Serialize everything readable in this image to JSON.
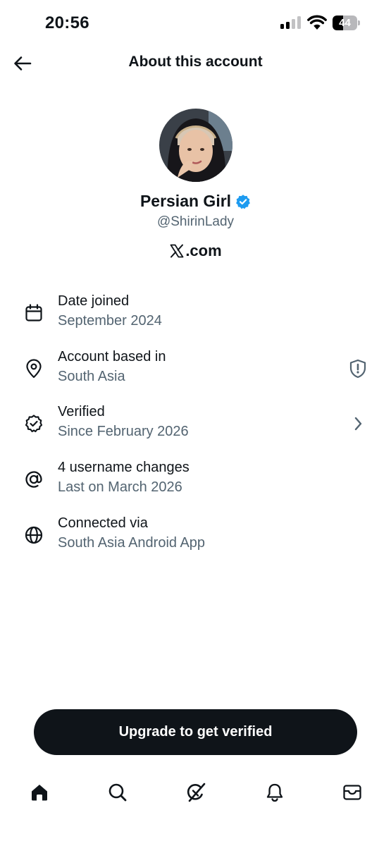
{
  "status_bar": {
    "time": "20:56",
    "battery_level": "44",
    "battery_percent": 44
  },
  "header": {
    "back_icon": "arrow-left-icon",
    "title": "About this account"
  },
  "profile": {
    "name": "Persian Girl",
    "handle": "@ShirinLady",
    "verified_color": "#1d9bf0",
    "source_domain": ".com",
    "source_logo_icon": "x-logo-icon"
  },
  "info_rows": [
    {
      "icon": "calendar-icon",
      "label": "Date joined",
      "value": "September 2024"
    },
    {
      "icon": "location-pin-icon",
      "label": "Account based in",
      "value": "South Asia",
      "trailing_icon": "shield-alert-icon"
    },
    {
      "icon": "verified-badge-icon",
      "label": "Verified",
      "value": "Since February 2026",
      "trailing_icon": "chevron-right-icon"
    },
    {
      "icon": "at-sign-icon",
      "label": "4 username changes",
      "value": "Last on March 2026"
    },
    {
      "icon": "globe-icon",
      "label": "Connected via",
      "value": "South Asia Android App"
    }
  ],
  "cta": {
    "label": "Upgrade to get verified"
  },
  "bottom_nav": [
    {
      "icon": "home-icon",
      "active": true
    },
    {
      "icon": "search-icon"
    },
    {
      "icon": "grok-icon"
    },
    {
      "icon": "bell-icon"
    },
    {
      "icon": "mail-icon"
    }
  ],
  "colors": {
    "text_primary": "#0f1419",
    "text_secondary": "#536471",
    "button_bg": "#0f1419",
    "verified_blue": "#1d9bf0"
  }
}
